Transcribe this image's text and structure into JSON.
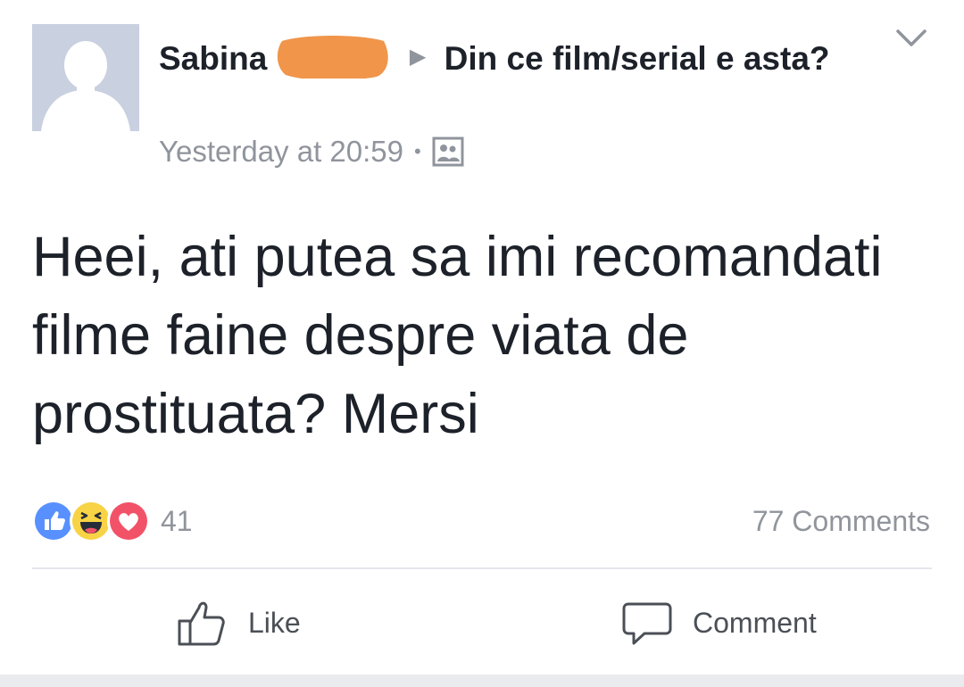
{
  "post": {
    "author": "Sabina",
    "group": "Din ce film/serial e asta?",
    "timestamp": "Yesterday at 20:59",
    "separator": "•",
    "arrow": "▶",
    "text": "Heei, ati putea sa imi recomandati filme faine despre viata de prostituata? Mersi"
  },
  "reactions": {
    "types": [
      "like-icon",
      "haha-icon",
      "love-icon"
    ],
    "count": "41"
  },
  "comments_count": "77 Comments",
  "actions": {
    "like_label": "Like",
    "comment_label": "Comment"
  },
  "colors": {
    "redaction": "#f0954a",
    "like_blue": "#5890ff",
    "haha_yellow": "#f7d345",
    "love_red": "#f25268",
    "meta_gray": "#90949c"
  }
}
